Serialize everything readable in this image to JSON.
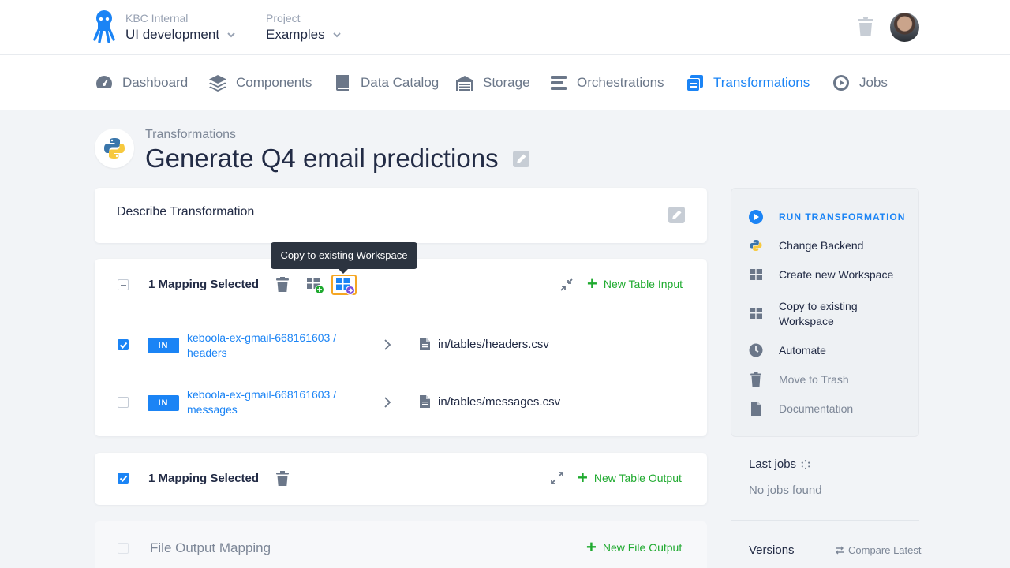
{
  "header": {
    "org_label": "KBC Internal",
    "org_value": "UI development",
    "project_label": "Project",
    "project_value": "Examples"
  },
  "nav": {
    "items": [
      {
        "label": "Dashboard",
        "icon": "gauge-icon"
      },
      {
        "label": "Components",
        "icon": "layers-icon"
      },
      {
        "label": "Data Catalog",
        "icon": "book-icon"
      },
      {
        "label": "Storage",
        "icon": "warehouse-icon"
      },
      {
        "label": "Orchestrations",
        "icon": "bars-icon"
      },
      {
        "label": "Transformations",
        "icon": "transformations-icon",
        "active": true
      },
      {
        "label": "Jobs",
        "icon": "play-circle-icon"
      }
    ]
  },
  "page": {
    "breadcrumb": "Transformations",
    "title": "Generate Q4 email predictions",
    "describe_label": "Describe Transformation"
  },
  "input_mapping": {
    "selected_label": "1 Mapping Selected",
    "tooltip": "Copy to existing Workspace",
    "add_label": "New Table Input",
    "rows": [
      {
        "badge": "IN",
        "source": "keboola-ex-gmail-668161603 / headers",
        "destination": "in/tables/headers.csv",
        "checked": true
      },
      {
        "badge": "IN",
        "source": "keboola-ex-gmail-668161603 / messages",
        "destination": "in/tables/messages.csv",
        "checked": false
      }
    ]
  },
  "output_mapping": {
    "selected_label": "1 Mapping Selected",
    "add_label": "New Table Output"
  },
  "file_output": {
    "label": "File Output Mapping",
    "add_label": "New File Output"
  },
  "sidebar": {
    "run": "RUN TRANSFORMATION",
    "change_backend": "Change Backend",
    "create_workspace": "Create new Workspace",
    "copy_workspace": "Copy to existing Workspace",
    "automate": "Automate",
    "trash": "Move to Trash",
    "docs": "Documentation",
    "last_jobs": "Last jobs",
    "no_jobs": "No jobs found",
    "versions": "Versions",
    "compare": "Compare Latest"
  },
  "colors": {
    "accent": "#1b84f5",
    "success": "#1faa2f",
    "text": "#222b45",
    "muted": "#7d8797"
  }
}
